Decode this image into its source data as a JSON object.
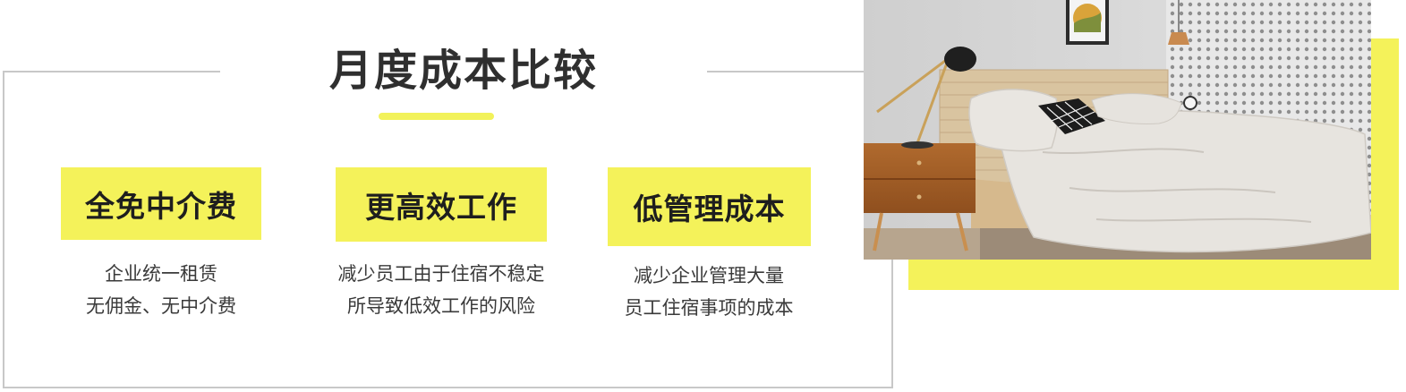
{
  "header": {
    "title": "月度成本比较"
  },
  "features": [
    {
      "title": "全免中介费",
      "lines": [
        "企业统一租赁",
        "无佣金、无中介费"
      ]
    },
    {
      "title": "更高效工作",
      "lines": [
        "减少员工由于住宿不稳定",
        "所导致低效工作的风险"
      ]
    },
    {
      "title": "低管理成本",
      "lines": [
        "减少企业管理大量",
        "员工住宿事项的成本"
      ]
    }
  ],
  "colors": {
    "accent_yellow": "#f4f25a",
    "border_gray": "#c8c8c8",
    "text_dark": "#2f2f2f"
  },
  "photo": {
    "subject": "bedroom-interior"
  }
}
